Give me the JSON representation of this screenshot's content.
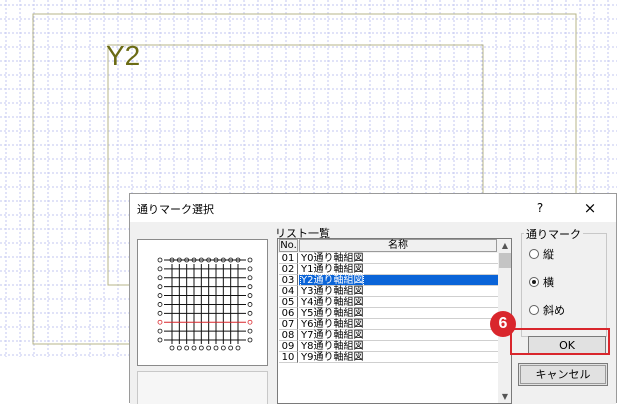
{
  "canvas": {
    "axis_label": "Y2",
    "grid_color": "#c3c7f0",
    "frame_color": "#b7b58a",
    "label_color": "#6b6b14"
  },
  "dialog": {
    "title": "通りマーク選択",
    "help_label": "?",
    "close_label": "×",
    "list_title": "リスト一覧",
    "columns": {
      "no": "No.",
      "name": "名称"
    },
    "rows": [
      {
        "no": "01",
        "name": "Y0通り軸組図"
      },
      {
        "no": "02",
        "name": "Y1通り軸組図"
      },
      {
        "no": "03",
        "name": "Y2通り軸組図",
        "selected": true
      },
      {
        "no": "04",
        "name": "Y3通り軸組図"
      },
      {
        "no": "05",
        "name": "Y4通り軸組図"
      },
      {
        "no": "06",
        "name": "Y5通り軸組図"
      },
      {
        "no": "07",
        "name": "Y6通り軸組図"
      },
      {
        "no": "08",
        "name": "Y7通り軸組図"
      },
      {
        "no": "09",
        "name": "Y8通り軸組図"
      },
      {
        "no": "10",
        "name": "Y9通り軸組図"
      }
    ],
    "mark_group": {
      "label": "通りマーク",
      "options": [
        {
          "label": "縦",
          "checked": false
        },
        {
          "label": "横",
          "checked": true
        },
        {
          "label": "斜め",
          "checked": false
        }
      ]
    },
    "ok_label": "OK",
    "cancel_label": "キャンセル",
    "selection_color": "#0a64d8"
  },
  "annotation": {
    "step_number": "6",
    "highlight_color": "#d9262c"
  }
}
